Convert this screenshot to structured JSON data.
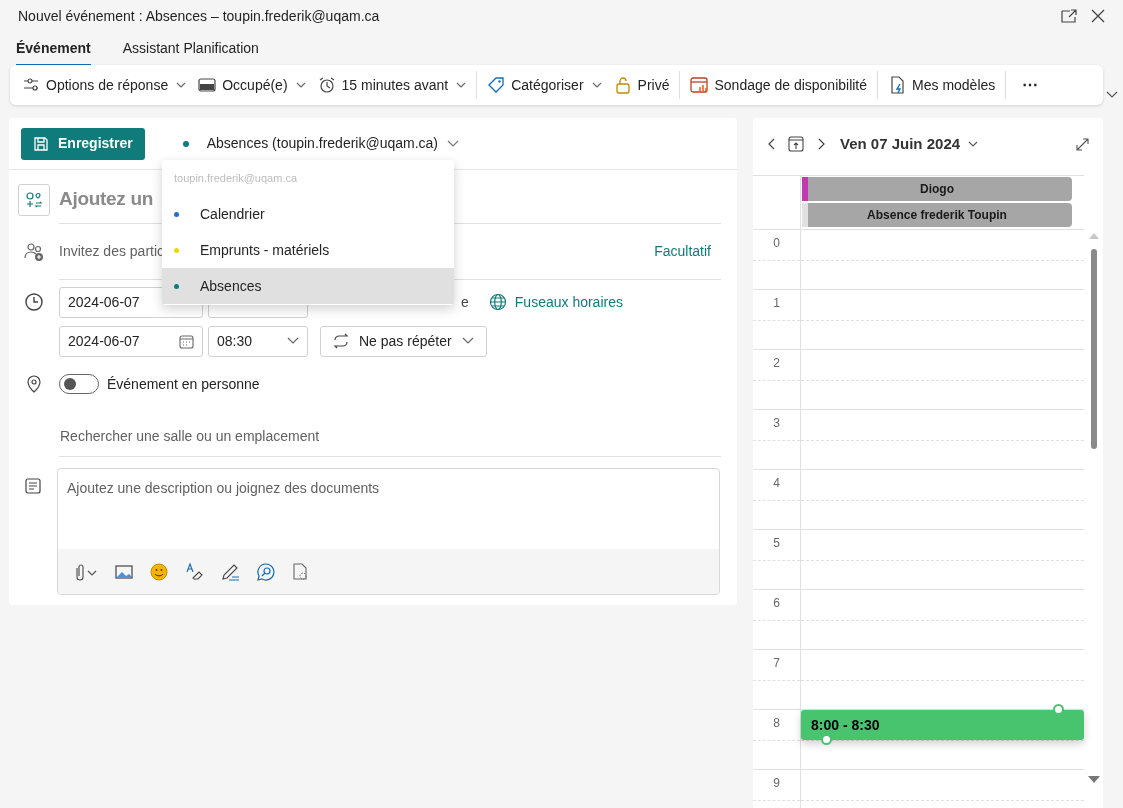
{
  "window": {
    "title": "Nouvel événement : Absences – toupin.frederik@uqam.ca"
  },
  "tabs": [
    {
      "label": "Événement",
      "selected": true
    },
    {
      "label": "Assistant Planification",
      "selected": false
    }
  ],
  "toolbar": {
    "groups": [
      [
        {
          "label": "Options de réponse",
          "dropdown": true
        },
        {
          "label": "Occupé(e)",
          "dropdown": true
        },
        {
          "label": "15 minutes avant",
          "dropdown": true
        }
      ],
      [
        {
          "label": "Catégoriser",
          "dropdown": true
        },
        {
          "label": "Privé",
          "dropdown": false
        }
      ],
      [
        {
          "label": "Sondage de disponibilité",
          "dropdown": false
        }
      ],
      [
        {
          "label": "Mes modèles",
          "dropdown": false
        }
      ],
      [
        {
          "label": "⋯",
          "dropdown": false
        }
      ]
    ]
  },
  "form": {
    "save_button": "Enregistrer",
    "calendar_picker": {
      "label": "Absences (toupin.frederik@uqam.ca)",
      "color": "#0f7b7b"
    },
    "calendar_menu": {
      "header": "toupin.frederik@uqam.ca",
      "options": [
        {
          "label": "Calendrier",
          "color": "#1f6fd6",
          "selected": false
        },
        {
          "label": "Emprunts - matériels",
          "color": "#f2d600",
          "selected": false
        },
        {
          "label": "Absences",
          "color": "#0f7b7b",
          "selected": true
        }
      ]
    },
    "title_placeholder": "Ajoutez un",
    "attendees_placeholder": "Invitez des partic",
    "optional_link": "Facultatif",
    "start_date": "2024-06-07",
    "all_day_fragment": "e",
    "timezones_link": "Fuseaux horaires",
    "end_date": "2024-06-07",
    "end_time": "08:30",
    "repeat": "Ne pas répéter",
    "in_person": {
      "label": "Événement en personne",
      "on": false
    },
    "location_placeholder": "Rechercher une salle ou un emplacement",
    "description_placeholder": "Ajoutez une description ou joignez des documents"
  },
  "calendar": {
    "date": "Ven 07 Juin 2024",
    "all_day_events": [
      {
        "title": "Diogo",
        "color": "#c239b3"
      },
      {
        "title": "Absence frederik Toupin",
        "color": "#e1e1e1"
      }
    ],
    "hours": [
      "0",
      "1",
      "2",
      "3",
      "4",
      "5",
      "6",
      "7",
      "8",
      "9"
    ],
    "new_event": {
      "time": "8:00 - 8:30"
    }
  }
}
